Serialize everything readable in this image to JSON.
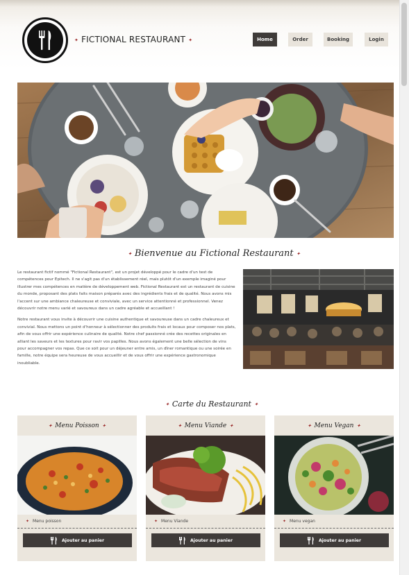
{
  "header": {
    "brand": "FICTIONAL RESTAURANT",
    "nav": [
      {
        "label": "Home",
        "active": true
      },
      {
        "label": "Order",
        "active": false
      },
      {
        "label": "Booking",
        "active": false
      },
      {
        "label": "Login",
        "active": false
      }
    ]
  },
  "welcome": {
    "title": "Bienvenue au Fictional Restaurant",
    "paragraphs": [
      "Le restaurant fictif nommé \"Fictional Restaurant\", est un projet développé pour le cadre d'un test de compétences pour Epitech. Il ne s'agit pas d'un établissement réel, mais plutôt d'un exemple imaginé pour illustrer mes compétences en matière de développement web. Fictional Restaurant est un restaurant de cuisine du monde, proposant des plats faits maison préparés avec des ingrédients frais et de qualité. Nous avons mis l'accent sur une ambiance chaleureuse et conviviale, avec un service attentionné et professionnel. Venez découvrir notre menu varié et savoureux dans un cadre agréable et accueillant !",
      "Notre restaurant vous invite à découvrir une cuisine authentique et savoureuse dans un cadre chaleureux et convivial. Nous mettons un point d'honneur à sélectionner des produits frais et locaux pour composer nos plats, afin de vous offrir une expérience culinaire de qualité. Notre chef passionné crée des recettes originales en alliant les saveurs et les textures pour ravir vos papilles. Nous avons également une belle sélection de vins pour accompagner vos repas. Que ce soit pour un déjeuner entre amis, un dîner romantique ou une soirée en famille, notre équipe sera heureuse de vous accueillir et de vous offrir une expérience gastronomique inoubliable."
    ]
  },
  "menu": {
    "title": "Carte du Restaurant",
    "cards": [
      {
        "title": "Menu Poisson",
        "item": "Menu poisson",
        "button": "Ajouter au panier"
      },
      {
        "title": "Menu Viande",
        "item": "Menu Viande",
        "button": "Ajouter au panier"
      },
      {
        "title": "Menu Vegan",
        "item": "Menu vegan",
        "button": "Ajouter au panier"
      }
    ]
  },
  "colors": {
    "accent": "#9b2a2a",
    "dark": "#3f3b39",
    "card_bg": "#ebe6dd"
  },
  "icons": [
    "fork-knife-logo-icon",
    "cutlery-icon",
    "star-icon"
  ]
}
